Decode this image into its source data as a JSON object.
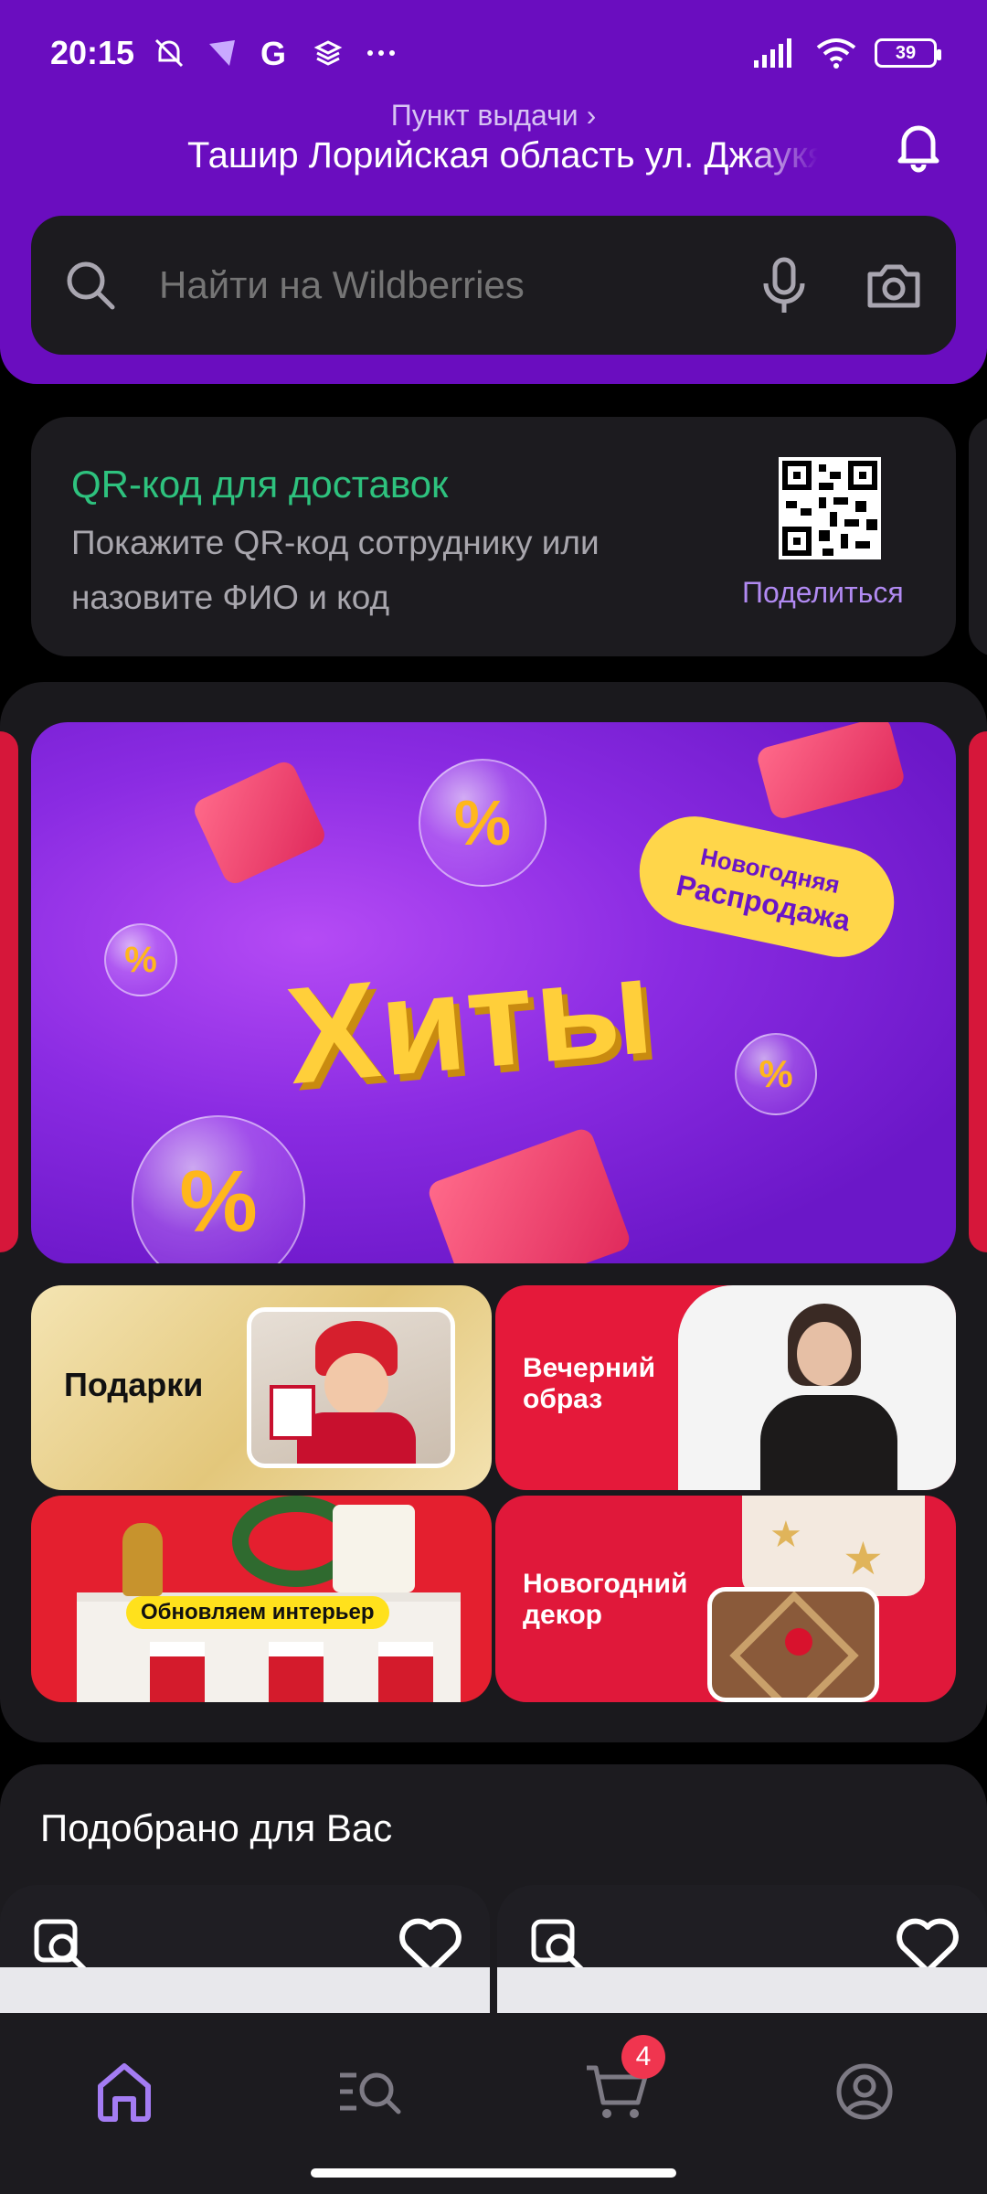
{
  "status_bar": {
    "time": "20:15",
    "battery": "39",
    "icons": [
      "bell-off-icon",
      "vpn-shield-icon",
      "google-icon",
      "layers-icon",
      "more-dots-icon",
      "signal-icon",
      "wifi-icon",
      "battery-icon"
    ]
  },
  "header": {
    "pickup_label": "Пункт выдачи ›",
    "pickup_address": "Ташир Лорийская область ул. Джаукян",
    "search_placeholder": "Найти на Wildberries",
    "accent_color": "#6a0dbf"
  },
  "qr_card": {
    "title": "QR-код для доставок",
    "description": "Покажите QR-код сотруднику или назовите ФИО и код",
    "share_label": "Поделиться",
    "title_color": "#2ec27e",
    "share_color": "#b18af2"
  },
  "banners": {
    "hero": {
      "title": "Хиты",
      "badge_line1": "Новогодняя",
      "badge_line2": "Распродажа"
    },
    "tiles": [
      {
        "label": "Подарки"
      },
      {
        "label": "Вечерний образ"
      },
      {
        "label": "Обновляем интерьер"
      },
      {
        "label": "Новогодний декор"
      }
    ]
  },
  "recommendations": {
    "title": "Подобрано для Вас"
  },
  "bottom_nav": {
    "items": [
      "home-icon",
      "catalog-search-icon",
      "cart-icon",
      "profile-icon"
    ],
    "cart_count": "4",
    "active_color": "#a47cf3"
  }
}
